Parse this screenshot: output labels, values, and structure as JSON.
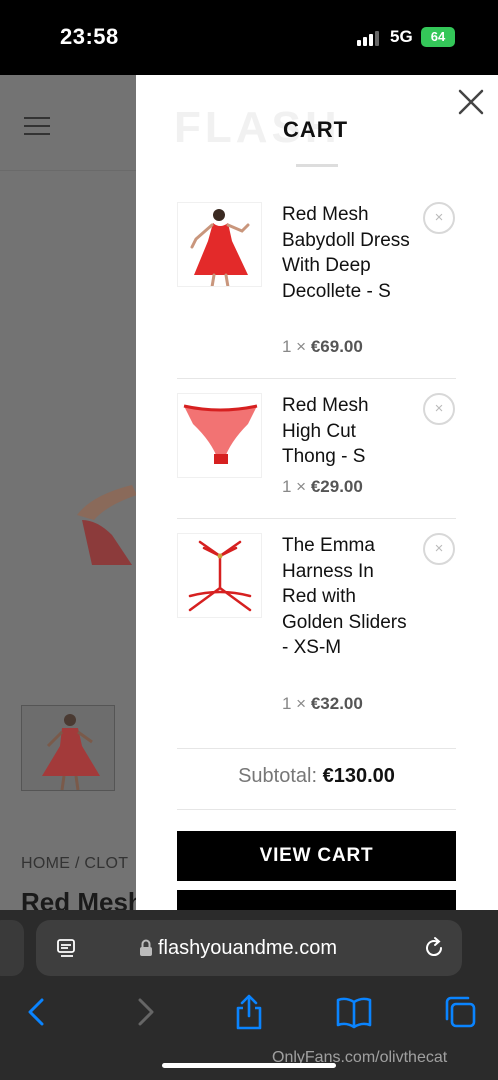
{
  "status": {
    "time": "23:58",
    "network": "5G",
    "battery": "64"
  },
  "background": {
    "breadcrumb": "HOME  /  CLOT",
    "title": "Red Mesh B"
  },
  "cart": {
    "logo": "FLASH",
    "title": "CART",
    "items": [
      {
        "name": "Red Mesh Babydoll Dress With Deep Decollete - S",
        "qty": "1 ×",
        "price": "€69.00",
        "image": "red-babydoll-dress"
      },
      {
        "name": "Red Mesh High Cut Thong - S",
        "qty": "1 ×",
        "price": "€29.00",
        "image": "red-thong"
      },
      {
        "name": "The Emma Harness In Red with Golden Sliders - XS-M",
        "qty": "1 ×",
        "price": "€32.00",
        "image": "red-harness"
      }
    ],
    "remove_icon": "×",
    "subtotal_label": "Subtotal:",
    "subtotal_value": "€130.00",
    "view_cart_label": "VIEW CART"
  },
  "browser": {
    "url": "flashyouandme.com"
  },
  "watermark": "OnlyFans.com/olivthecat",
  "colors": {
    "battery": "#34c759",
    "accent_red": "#e32a2a",
    "ios_blue": "#0a84ff"
  }
}
